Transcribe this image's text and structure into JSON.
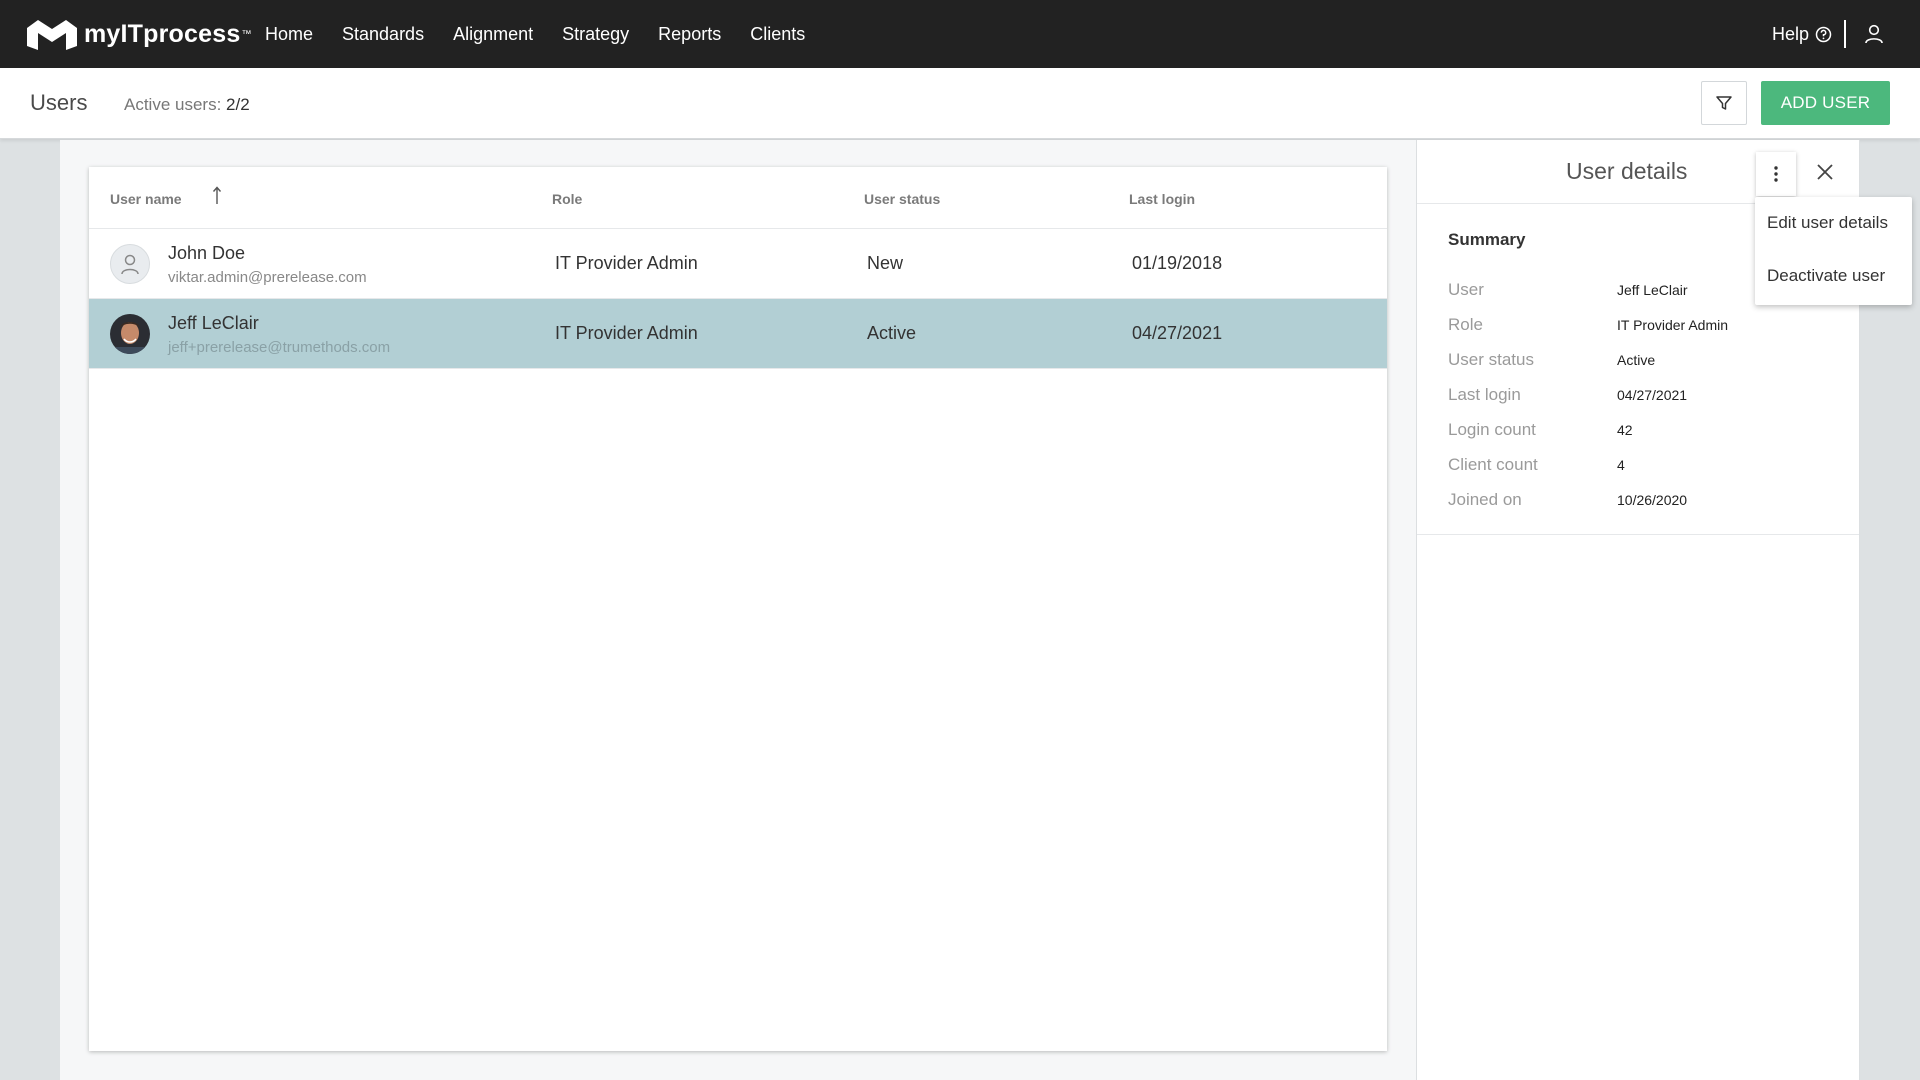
{
  "brand": {
    "name": "myITprocess",
    "tm": "™"
  },
  "nav": {
    "items": [
      "Home",
      "Standards",
      "Alignment",
      "Strategy",
      "Reports",
      "Clients"
    ],
    "help_label": "Help"
  },
  "header": {
    "title": "Users",
    "active_users_label": "Active users:",
    "active_users_count": "2/2",
    "add_user_label": "ADD USER"
  },
  "table": {
    "columns": {
      "name": "User name",
      "role": "Role",
      "status": "User status",
      "last_login": "Last login"
    },
    "rows": [
      {
        "name": "John Doe",
        "email": "viktar.admin@prerelease.com",
        "role": "IT Provider Admin",
        "status": "New",
        "last_login": "01/19/2018",
        "selected": false
      },
      {
        "name": "Jeff LeClair",
        "email": "jeff+prerelease@trumethods.com",
        "role": "IT Provider Admin",
        "status": "Active",
        "last_login": "04/27/2021",
        "selected": true
      }
    ]
  },
  "details": {
    "title": "User details",
    "summary_label": "Summary",
    "fields": [
      {
        "label": "User",
        "value": "Jeff LeClair"
      },
      {
        "label": "Role",
        "value": "IT Provider Admin"
      },
      {
        "label": "User status",
        "value": "Active"
      },
      {
        "label": "Last login",
        "value": "04/27/2021"
      },
      {
        "label": "Login count",
        "value": "42"
      },
      {
        "label": "Client count",
        "value": "4"
      },
      {
        "label": "Joined on",
        "value": "10/26/2020"
      }
    ]
  },
  "menu": {
    "items": [
      "Edit user details",
      "Deactivate user"
    ]
  },
  "colors": {
    "accent": "#4cb87d",
    "selected_row": "#b2cfd4",
    "topbar": "#222222"
  }
}
